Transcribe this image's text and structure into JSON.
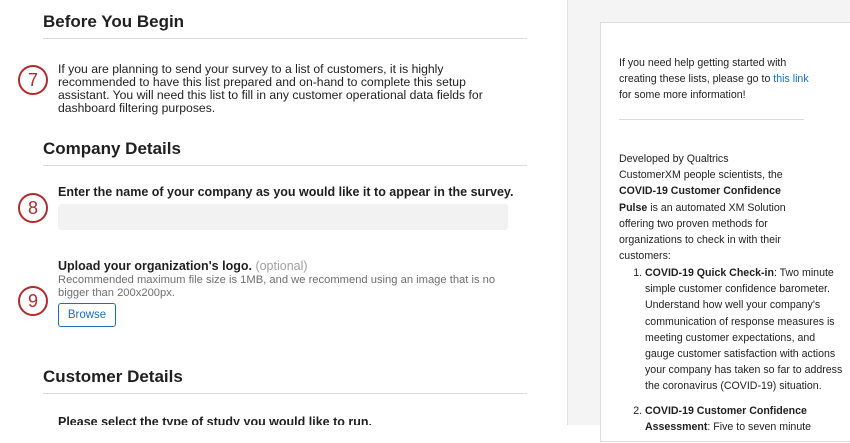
{
  "before": {
    "title": "Before You Begin",
    "step": "7",
    "text": "If you are planning to send your survey to a list of customers, it is highly recommended to have this list prepared and on-hand to complete this setup assistant. You will need this list to fill in any customer operational data fields for dashboard filtering purposes."
  },
  "company": {
    "title": "Company Details",
    "step_name": "8",
    "name_label": "Enter the name of your company as you would like it to appear in the survey.",
    "name_value": "",
    "step_logo": "9",
    "logo_label": "Upload your organization's logo.",
    "logo_optional": "(optional)",
    "logo_hint": "Recommended maximum file size is 1MB, and we recommend using an image that is no bigger than 200x200px.",
    "browse_label": "Browse"
  },
  "customer": {
    "title": "Customer Details",
    "study_label": "Please select the type of study you would like to run."
  },
  "sidebar": {
    "help_text": "If you need help getting started with creating these lists, please go to ",
    "help_link": "this link",
    "help_text_after": " for some more information!",
    "intro_before": "Developed by Qualtrics CustomerXM people scientists, the ",
    "intro_bold": "COVID-19 Customer Confidence Pulse",
    "intro_after": " is an automated XM Solution offering two proven methods for organizations to check in with their customers:",
    "items": [
      {
        "title": "COVID-19 Quick Check-in",
        "text": ": Two minute simple customer confidence barometer. Understand how well your company's communication of response measures is meeting customer expectations, and gauge customer satisfaction with actions your company has taken so far to address the coronavirus (COVID-19) situation."
      },
      {
        "title": "COVID-19 Customer Confidence Assessment",
        "text": ": Five to seven minute"
      }
    ]
  }
}
